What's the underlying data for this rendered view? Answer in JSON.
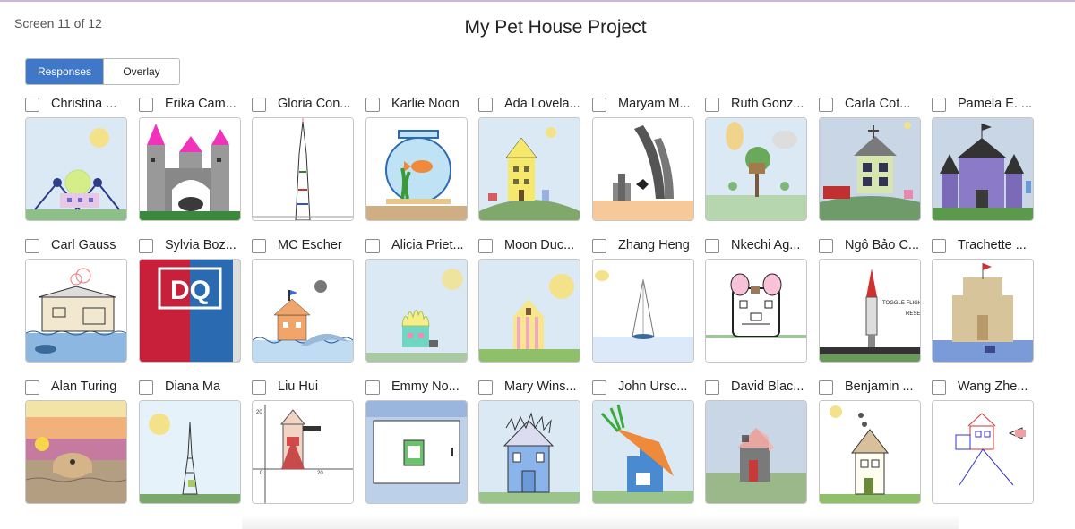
{
  "header": {
    "screen_label": "Screen 11 of 12",
    "title": "My Pet House Project"
  },
  "view_toggle": {
    "responses_label": "Responses",
    "overlay_label": "Overlay",
    "active": "Responses"
  },
  "students": [
    {
      "name": "Christina ...",
      "art": "tennis-house"
    },
    {
      "name": "Erika Cam...",
      "art": "castle-pink"
    },
    {
      "name": "Gloria Con...",
      "art": "tall-tower"
    },
    {
      "name": "Karlie Noon",
      "art": "fishbowl"
    },
    {
      "name": "Ada Lovela...",
      "art": "yellow-house"
    },
    {
      "name": "Maryam M...",
      "art": "modern-building"
    },
    {
      "name": "Ruth Gonz...",
      "art": "treehouse"
    },
    {
      "name": "Carla Cot...",
      "art": "green-house"
    },
    {
      "name": "Pamela E. ...",
      "art": "purple-castle"
    },
    {
      "name": "Carl Gauss",
      "art": "beach-house"
    },
    {
      "name": "Sylvia Boz...",
      "art": "dq-sign"
    },
    {
      "name": "MC Escher",
      "art": "orange-house-sea"
    },
    {
      "name": "Alicia Priet...",
      "art": "flame-house"
    },
    {
      "name": "Moon Duc...",
      "art": "striped-house"
    },
    {
      "name": "Zhang Heng",
      "art": "cone"
    },
    {
      "name": "Nkechi Ag...",
      "art": "mouse-house"
    },
    {
      "name": "Ngô Bảo C...",
      "art": "rocket"
    },
    {
      "name": "Trachette ...",
      "art": "sandcastle"
    },
    {
      "name": "Alan Turing",
      "art": "sunset-dome"
    },
    {
      "name": "Diana Ma",
      "art": "eiffel"
    },
    {
      "name": "Liu Hui",
      "art": "graph-house"
    },
    {
      "name": "Emmy No...",
      "art": "tablet-frame"
    },
    {
      "name": "Mary Wins...",
      "art": "blue-house"
    },
    {
      "name": "John Ursc...",
      "art": "carrot"
    },
    {
      "name": "David Blac...",
      "art": "gray-house"
    },
    {
      "name": "Benjamin ...",
      "art": "tall-narrow-house"
    },
    {
      "name": "Wang Zhe...",
      "art": "line-house"
    }
  ],
  "art_text": {
    "sylvia": "DQ",
    "rocket_label_1": "TOGGLE FLIGH",
    "rocket_label_2": "RESE",
    "graph_y_tick": "20",
    "graph_origin": "0",
    "graph_x_tick": "20"
  },
  "colors": {
    "accent": "#3f78c9",
    "sky": "#dbe9f5",
    "grass": "#9fc79a"
  }
}
